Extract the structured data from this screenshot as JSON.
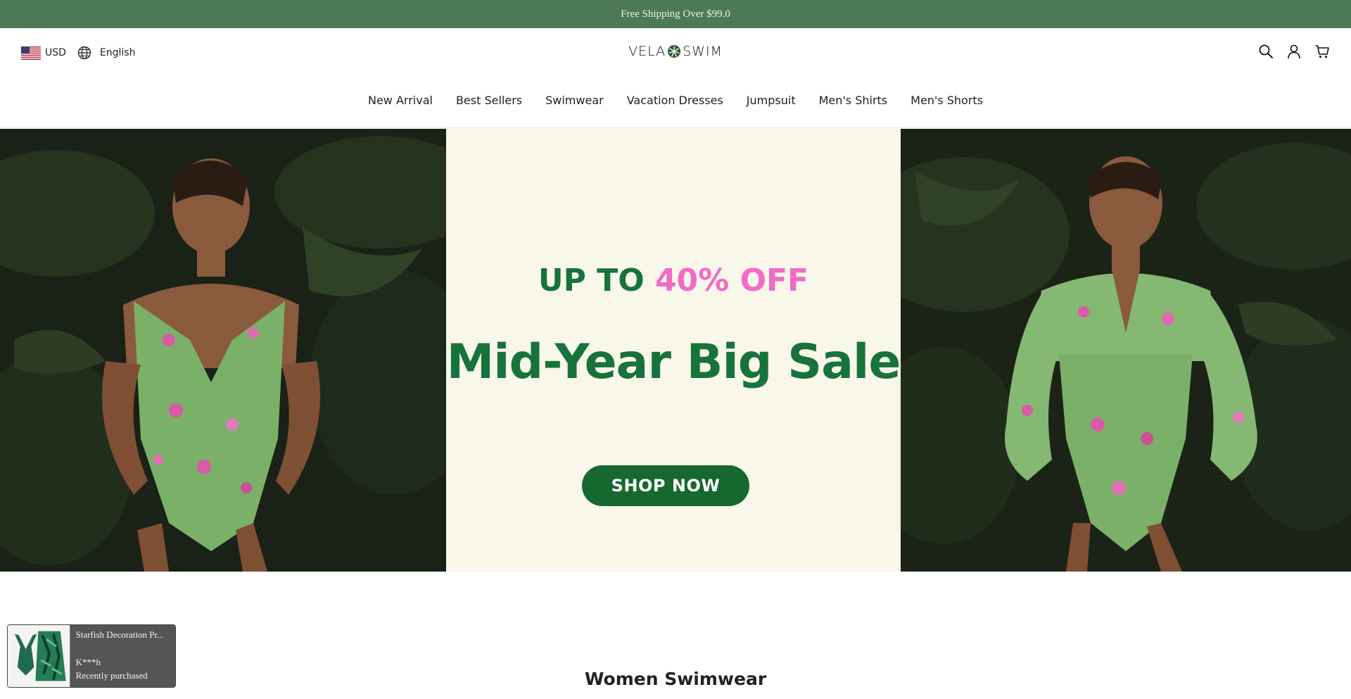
{
  "announcement": {
    "text": "Free Shipping Over $99.0",
    "lead_glyph": "",
    "trail_glyph": ""
  },
  "header": {
    "currency": "USD",
    "language": "English",
    "logo_left": "VELA",
    "logo_right": "SWIM",
    "icons": [
      "search-icon",
      "account-icon",
      "cart-icon"
    ]
  },
  "nav": {
    "items": [
      "New Arrival",
      "Best Sellers",
      "Swimwear",
      "Vacation Dresses",
      "Jumpsuit",
      "Men's Shirts",
      "Men's Shorts"
    ]
  },
  "hero": {
    "promo_prefix": "UP TO",
    "promo_accent": "40% OFF",
    "title": "Mid-Year Big Sale",
    "cta": "SHOP NOW"
  },
  "section": {
    "heading": "Women Swimwear"
  },
  "recent_purchase": {
    "product": "Starfish Decoration Pr...",
    "buyer": "K***h",
    "status": "Recently purchased"
  },
  "colors": {
    "announcement_bg": "#4b7a55",
    "brand_green": "#17733a",
    "accent_pink": "#f26bc4",
    "cta_bg": "#16682f",
    "hero_center_bg": "#f9f6ea",
    "popup_bg": "#555555"
  }
}
